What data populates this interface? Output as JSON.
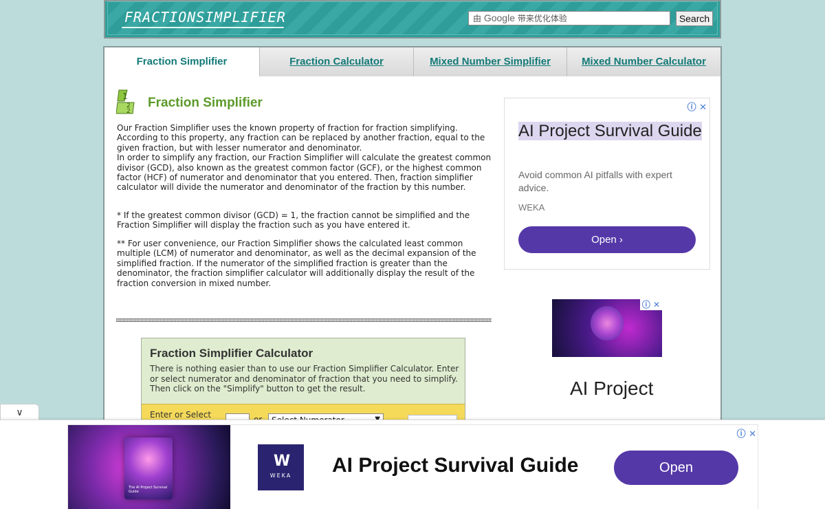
{
  "header": {
    "logo_text": "FRACTIONSIMPLIFIER",
    "search": {
      "prefix": "由",
      "google": "Google",
      "placeholder": "带来优化体验",
      "button": "Search"
    }
  },
  "tabs": [
    {
      "label": "Fraction Simplifier",
      "active": true
    },
    {
      "label": "Fraction Calculator",
      "active": false
    },
    {
      "label": "Mixed Number Simplifier",
      "active": false
    },
    {
      "label": "Mixed Number Calculator",
      "active": false
    }
  ],
  "content": {
    "title": "Fraction Simplifier",
    "icon_digits": [
      "1",
      "2",
      "2"
    ],
    "paragraph1": "Our Fraction Simplifier uses the known property of fraction for fraction simplifying. According to this property, any fraction can be replaced by another fraction, equal to the given fraction, but with lesser numerator and denominator.",
    "paragraph1b": "In order to simplify any fraction, our Fraction Simplifier will calculate the greatest common divisor (GCD), also known as the greatest common factor (GCF), or the highest common factor (HCF) of numerator and denominator that you entered. Then, fraction simplifier calculator will divide the numerator and denominator of the fraction by this number.",
    "paragraph2": "* If the greatest common divisor (GCD) = 1, the fraction cannot be simplified and the Fraction Simplifier will display the fraction such as you have entered it.",
    "paragraph3": "** For user convenience, our Fraction Simplifier shows the calculated least common multiple (LCM) of numerator and denominator, as well as the decimal expansion of the simplified fraction. If the numerator of the simplified fraction is greater than the denominator, the fraction simplifier calculator will additionally display the result of the fraction conversion in mixed number."
  },
  "calculator": {
    "title": "Fraction Simplifier Calculator",
    "description": "There is nothing easier than to use our Fraction Simplifier Calculator. Enter or select numerator and denominator of fraction that you need to simplify. Then click on the \"Simplify\" button to get the result.",
    "enter_label": "Enter or Select",
    "or_text": "or",
    "numerator_select": "Select Numerator"
  },
  "ad_side": {
    "badge": "ⓘ ✕",
    "title": "AI Project Survival Guide",
    "description": "Avoid common AI pitfalls with expert advice.",
    "brand": "WEKA",
    "button": "Open ›"
  },
  "ad_side2": {
    "badge": "ⓘ ✕",
    "text": "AI Project"
  },
  "anchor_ad": {
    "badge": "ⓘ ✕",
    "cover_text": "The AI Project Survival Guide",
    "logo_mark": "W",
    "logo_word": "WEKA",
    "title": "AI Project Survival Guide",
    "button": "Open"
  },
  "collapse_icon": "chevron-down-icon"
}
